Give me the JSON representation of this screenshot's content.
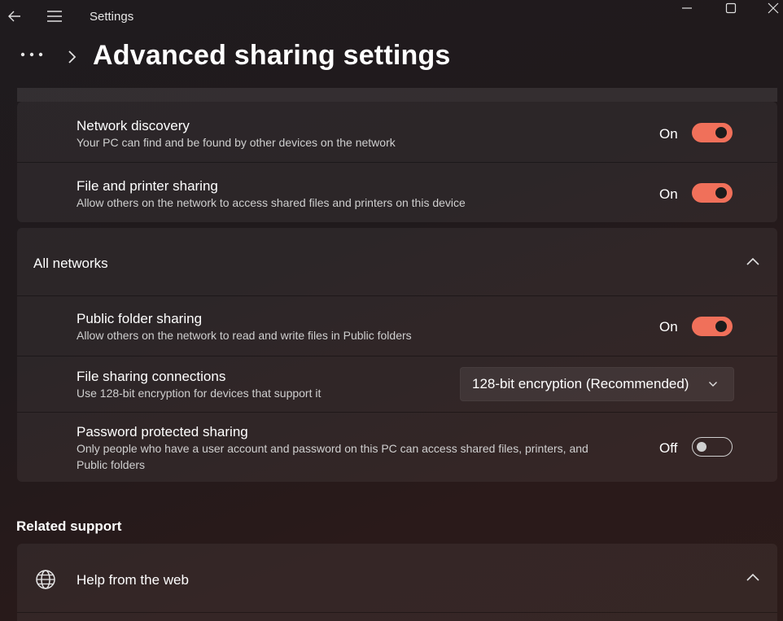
{
  "window": {
    "title": "Settings"
  },
  "header": {
    "page_title": "Advanced sharing settings"
  },
  "private_networks": {
    "rows": [
      {
        "title": "Network discovery",
        "description": "Your PC can find and be found by other devices on the network",
        "state": "On",
        "enabled": true
      },
      {
        "title": "File and printer sharing",
        "description": "Allow others on the network to access shared files and printers on this device",
        "state": "On",
        "enabled": true
      }
    ]
  },
  "all_networks": {
    "header": "All networks",
    "rows": [
      {
        "title": "Public folder sharing",
        "description": "Allow others on the network to read and write files in Public folders",
        "state": "On",
        "enabled": true
      },
      {
        "title": "File sharing connections",
        "description": "Use 128-bit encryption for devices that support it",
        "selected": "128-bit encryption (Recommended)"
      },
      {
        "title": "Password protected sharing",
        "description_line1": "Only people who have a user account and password on this PC can access shared files, printers, and",
        "description_line2": "Public folders",
        "state": "Off",
        "enabled": false
      }
    ]
  },
  "related_support": {
    "title": "Related support",
    "items": [
      {
        "label": "Help from the web",
        "icon": "globe-icon"
      }
    ]
  },
  "colors": {
    "accent": "#f0705a",
    "background": "#201a1c",
    "card": "#2b2527"
  },
  "icons": [
    "back-arrow-icon",
    "hamburger-menu-icon",
    "minimize-icon",
    "maximize-icon",
    "close-icon",
    "more-dots-icon",
    "chevron-right-icon",
    "chevron-up-icon",
    "chevron-down-icon",
    "globe-icon"
  ]
}
